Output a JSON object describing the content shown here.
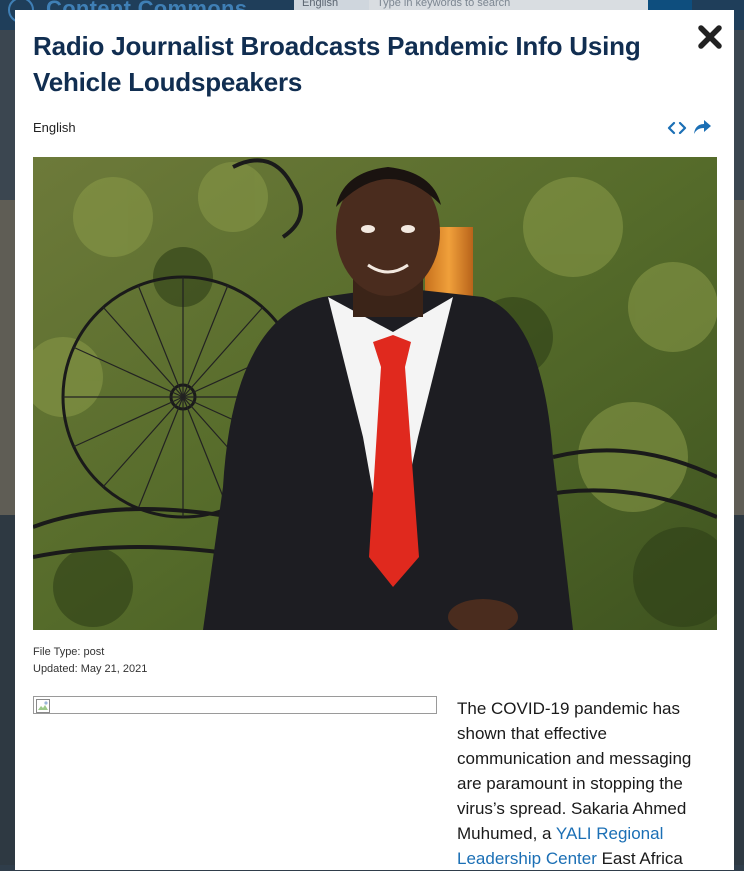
{
  "background": {
    "logo_text": "Content Commons",
    "language_select": "English",
    "search_placeholder": "Type in keywords to search"
  },
  "modal": {
    "title": "Radio Journalist Broadcasts Pandemic Info Using Vehicle Loudspeakers",
    "language": "English",
    "icons": {
      "close": "close-icon",
      "embed": "code-icon",
      "share": "share-arrow-icon"
    },
    "file_type": "File Type: post",
    "updated": "Updated: May 21, 2021",
    "article": {
      "text_before_link": "The COVID-19 pandemic has shown that effective communication and messaging are paramount in stopping the virus’s spread. Sakaria Ahmed Muhumed, a ",
      "link_text": "YALI Regional Leadership Center",
      "text_after_link": " East Africa"
    }
  },
  "colors": {
    "title": "#112e51",
    "link": "#1b6fb5",
    "overlay_header": "#1f3e5a"
  }
}
